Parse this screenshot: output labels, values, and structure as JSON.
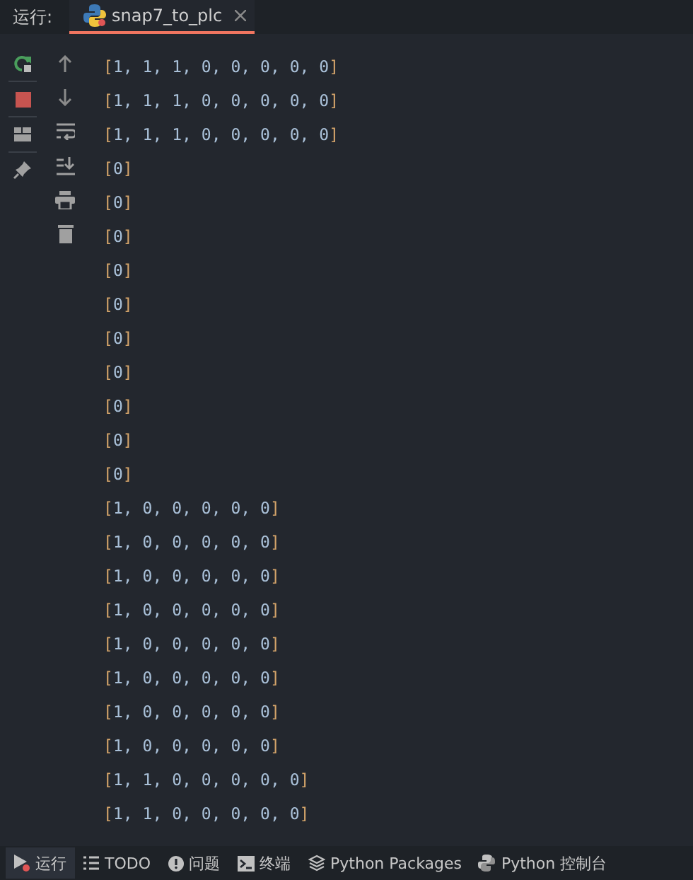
{
  "run_header": {
    "label": "运行:",
    "tabs": [
      {
        "label": "snap7_to_plc",
        "selected": true
      }
    ]
  },
  "console": {
    "lines": [
      "[1, 1, 1, 0, 0, 0, 0, 0]",
      "[1, 1, 1, 0, 0, 0, 0, 0]",
      "[1, 1, 1, 0, 0, 0, 0, 0]",
      "[0]",
      "[0]",
      "[0]",
      "[0]",
      "[0]",
      "[0]",
      "[0]",
      "[0]",
      "[0]",
      "[0]",
      "[1, 0, 0, 0, 0, 0]",
      "[1, 0, 0, 0, 0, 0]",
      "[1, 0, 0, 0, 0, 0]",
      "[1, 0, 0, 0, 0, 0]",
      "[1, 0, 0, 0, 0, 0]",
      "[1, 0, 0, 0, 0, 0]",
      "[1, 0, 0, 0, 0, 0]",
      "[1, 0, 0, 0, 0, 0]",
      "[1, 1, 0, 0, 0, 0, 0]",
      "[1, 1, 0, 0, 0, 0, 0]"
    ]
  },
  "bottom_bar": {
    "tabs": [
      {
        "label": "运行",
        "kind": "run",
        "selected": true
      },
      {
        "label": "TODO",
        "kind": "todo",
        "selected": false
      },
      {
        "label": "问题",
        "kind": "problems",
        "selected": false
      },
      {
        "label": "终端",
        "kind": "terminal",
        "selected": false
      },
      {
        "label": "Python Packages",
        "kind": "packages",
        "selected": false
      },
      {
        "label": "Python 控制台",
        "kind": "console",
        "selected": false
      }
    ]
  }
}
